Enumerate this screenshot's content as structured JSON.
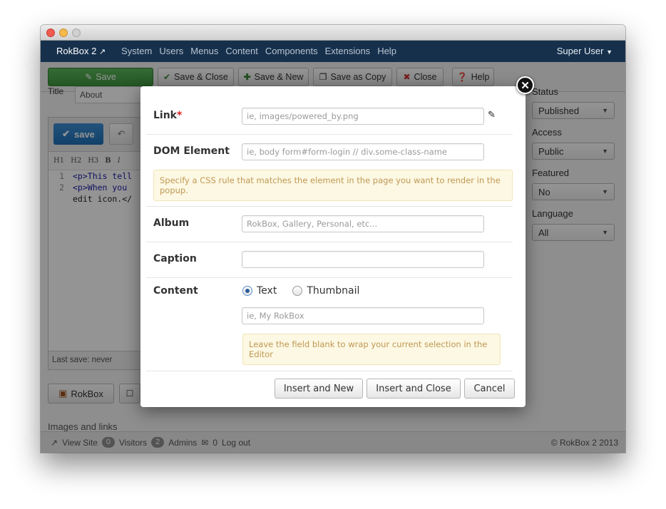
{
  "navbar": {
    "brand": "RokBox 2",
    "menu": [
      "System",
      "Users",
      "Menus",
      "Content",
      "Components",
      "Extensions",
      "Help"
    ],
    "user": "Super User"
  },
  "toolbar": {
    "save": "Save",
    "save_close": "Save & Close",
    "save_new": "Save & New",
    "save_copy": "Save as Copy",
    "close": "Close",
    "help": "Help"
  },
  "article": {
    "title_label": "Title",
    "title_value": "About",
    "editor_save": "save",
    "format_buttons": [
      "H1",
      "H2",
      "H3",
      "B",
      "I"
    ],
    "code_lines": [
      {
        "num": "1",
        "text": "<p>This tell"
      },
      {
        "num": "2",
        "text": "<p>When you"
      },
      {
        "num": "",
        "text": "edit icon.</"
      }
    ],
    "last_save": "Last save: never",
    "rokbox_button": "RokBox",
    "images_links": "Images and links"
  },
  "sidebar": {
    "status_label": "Status",
    "status_value": "Published",
    "access_label": "Access",
    "access_value": "Public",
    "featured_label": "Featured",
    "featured_value": "No",
    "language_label": "Language",
    "language_value": "All"
  },
  "footer": {
    "view_site": "View Site",
    "visitors_count": "0",
    "visitors": "Visitors",
    "admins_count": "2",
    "admins": "Admins",
    "messages_count": "0",
    "logout": "Log out",
    "copyright": "© RokBox 2 2013"
  },
  "modal": {
    "link_label": "Link",
    "required_marker": "*",
    "link_placeholder": "ie, images/powered_by.png",
    "dom_label": "DOM Element",
    "dom_placeholder": "ie, body form#form-login // div.some-class-name",
    "dom_note": "Specify a CSS rule that matches the element in the page you want to render in the popup.",
    "album_label": "Album",
    "album_placeholder": "RokBox, Gallery, Personal, etc...",
    "caption_label": "Caption",
    "caption_value": "",
    "content_label": "Content",
    "content_options": [
      "Text",
      "Thumbnail"
    ],
    "content_selected": "Text",
    "text_placeholder": "ie, My RokBox",
    "text_note": "Leave the field blank to wrap your current selection in the Editor",
    "insert_new": "Insert and New",
    "insert_close": "Insert and Close",
    "cancel": "Cancel"
  },
  "colors": {
    "navbar_bg": "#16304c",
    "save_green": "#5bb75b",
    "editor_save_blue": "#1f6fb6",
    "note_bg": "#fcf8e3",
    "note_text": "#c09853",
    "required_red": "#dd2222"
  }
}
